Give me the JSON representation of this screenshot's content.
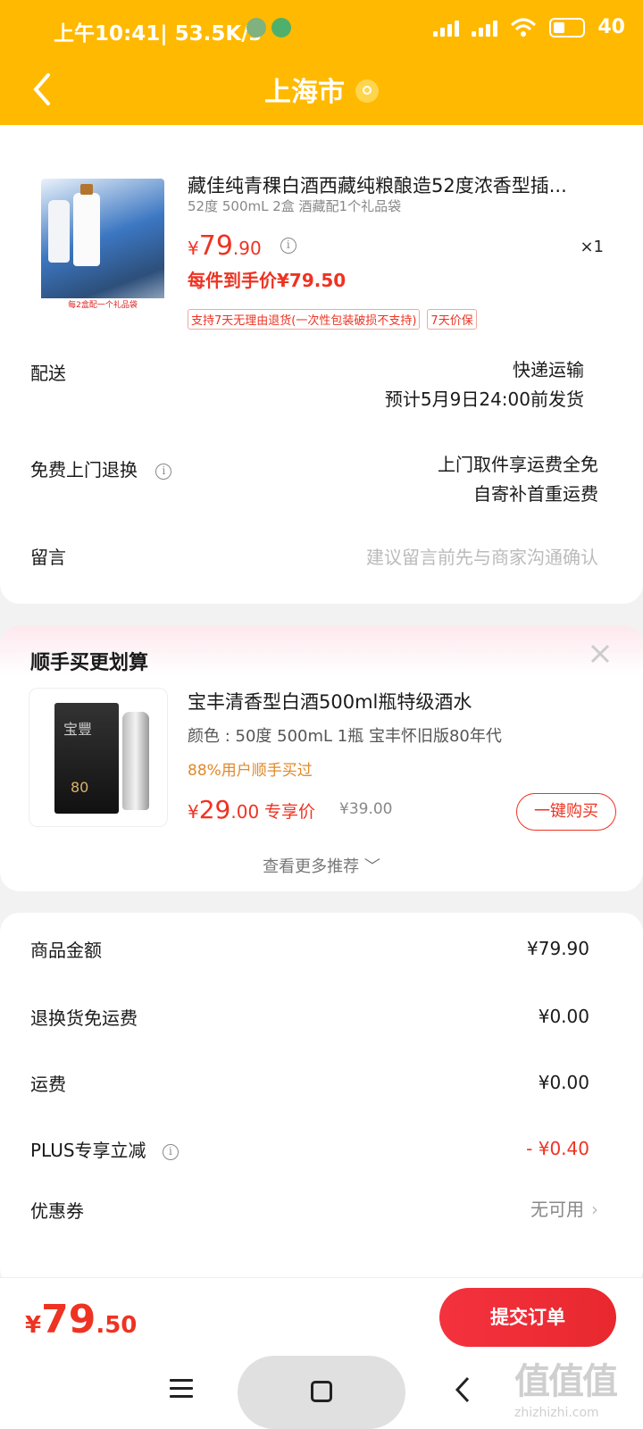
{
  "status_bar": {
    "time": "上午10:41",
    "speed": "| 53.5K/s",
    "battery_text": "40"
  },
  "header": {
    "title": "上海市"
  },
  "product": {
    "title": "藏佳纯青稞白酒西藏纯粮酿造52度浓香型插...",
    "spec": "52度 500mL 2盒 酒藏配1个礼品袋",
    "price_yen": "¥",
    "price_int": "79",
    "price_dec": ".90",
    "quantity": "×1",
    "unit_price": "每件到手价¥79.50",
    "tags": [
      "支持7天无理由退货(一次性包装破损不支持)",
      "7天价保"
    ],
    "image_caption": "每2盒配一个礼品袋"
  },
  "delivery": {
    "label": "配送",
    "method": "快递运输",
    "eta": "预计5月9日24:00前发货"
  },
  "return": {
    "label": "免费上门退换",
    "line1": "上门取件享运费全免",
    "line2": "自寄补首重运费"
  },
  "remark": {
    "label": "留言",
    "placeholder": "建议留言前先与商家沟通确认"
  },
  "recommend": {
    "title": "顺手买更划算",
    "name": "宝丰清香型白酒500ml瓶特级酒水",
    "spec": "颜色 : 50度 500mL 1瓶 宝丰怀旧版80年代",
    "bought": "88%用户顺手买过",
    "price_yen": "¥",
    "price_int": "29",
    "price_dec": ".00",
    "exclusive": "专享价",
    "original": "¥39.00",
    "buy_button": "一键购买",
    "more": "查看更多推荐 ﹀",
    "image_brand": "宝豐",
    "image_num": "80"
  },
  "summary": {
    "rows": [
      {
        "label": "商品金额",
        "value": "¥79.90"
      },
      {
        "label": "退换货免运费",
        "value": "¥0.00"
      },
      {
        "label": "运费",
        "value": "¥0.00"
      },
      {
        "label": "PLUS专享立减",
        "value": "- ¥0.40"
      },
      {
        "label": "优惠券",
        "value": "无可用"
      }
    ]
  },
  "footer": {
    "total_yen": "¥",
    "total_int": "79",
    "total_dec": ".50",
    "submit": "提交订单"
  },
  "watermark": {
    "big": "值值值",
    "small": "zhizhizhi.com"
  },
  "colors": {
    "header": "#ffb900",
    "accent_red": "#e32222",
    "bought_orange": "#e0892a"
  }
}
